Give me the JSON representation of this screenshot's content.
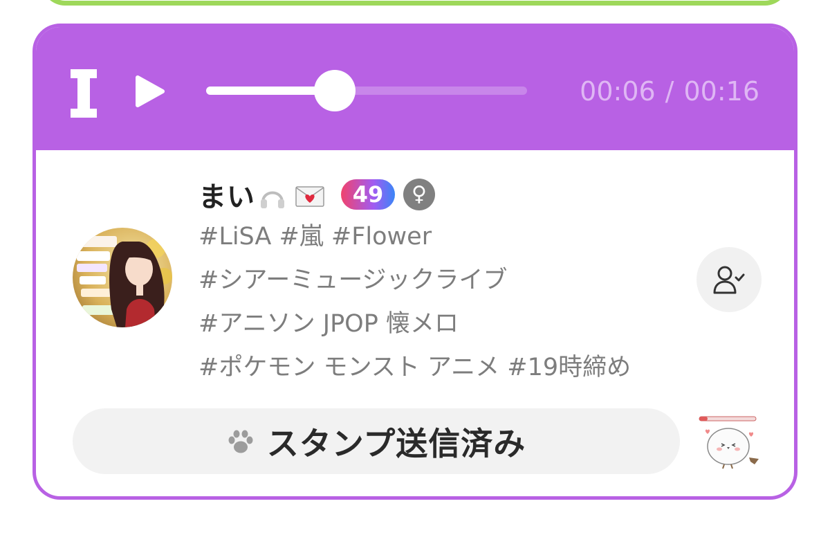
{
  "player": {
    "current_time": "00:06",
    "separator": "/",
    "total_time": "00:16",
    "progress_fraction": 0.4,
    "brand_icon": "brand-logo-icon",
    "play_icon": "play-icon"
  },
  "profile": {
    "name": "まい",
    "name_icons": [
      "headphones-icon",
      "love-letter-icon"
    ],
    "level": "49",
    "gender_symbol": "♀",
    "avatar_icon": "avatar",
    "tags": [
      "#LiSA #嵐 #Flower",
      "#シアーミュージックライブ",
      "#アニソン JPOP 懐メロ",
      "#ポケモン モンスト アニメ #19時締め"
    ]
  },
  "actions": {
    "follow_icon": "user-followed-icon",
    "stamp_label": "スタンプ送信済み",
    "stamp_icon": "paw-icon",
    "sticker_icon": "bird-sticker-icon"
  },
  "colors": {
    "card_accent": "#b861e4",
    "previous_card_border": "#9ed85a",
    "time_text": "#dfb6f4",
    "tag_text": "#7d7d7d",
    "gender_badge": "#808080"
  }
}
